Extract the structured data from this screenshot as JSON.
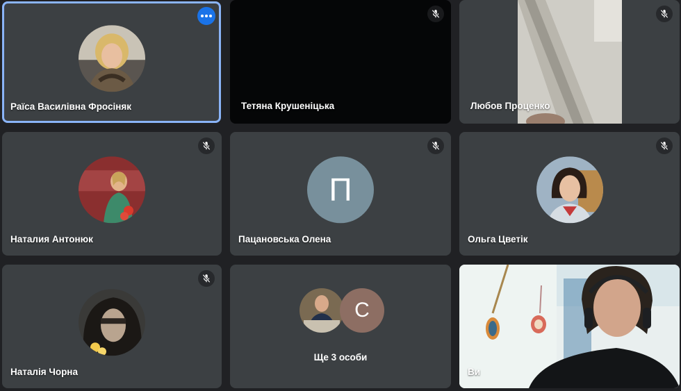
{
  "meeting": {
    "participants": [
      {
        "name": "Раїса Василівна Фросіняк",
        "tile": "avatar-photo",
        "muted": false,
        "speaking": true
      },
      {
        "name": "Тетяна Крушеніцька",
        "tile": "video-off",
        "muted": true
      },
      {
        "name": "Любов Проценко",
        "tile": "video",
        "muted": true
      },
      {
        "name": "Наталия Антонюк",
        "tile": "avatar-photo",
        "muted": true
      },
      {
        "name": "Пацановська Олена",
        "tile": "avatar-letter",
        "initial": "П",
        "avatar_color": "#78909c",
        "muted": true
      },
      {
        "name": "Ольга Цветік",
        "tile": "avatar-photo",
        "muted": true
      },
      {
        "name": "Наталія Чорна",
        "tile": "avatar-photo",
        "muted": true
      }
    ],
    "overflow": {
      "label": "Ще 3 особи",
      "initial": "С",
      "avatar_color": "#8d6e63"
    },
    "self": {
      "label": "Ви"
    },
    "icons": {
      "mute": "mic-off-icon",
      "more": "more-options-icon"
    },
    "colors": {
      "tile": "#3c4043",
      "background": "#202124",
      "active_border": "#8ab4f8",
      "more_button": "#1a73e8"
    }
  }
}
